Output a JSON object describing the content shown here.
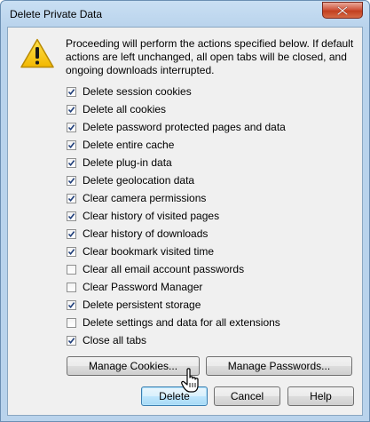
{
  "window": {
    "title": "Delete Private Data"
  },
  "icons": {
    "warning": "warning-icon",
    "close": "close-icon",
    "cursor": "hand-pointer-icon"
  },
  "message": "Proceeding will perform the actions specified below. If default actions are left unchanged, all open tabs will be closed, and ongoing downloads interrupted.",
  "options": [
    {
      "label": "Delete session cookies",
      "checked": true
    },
    {
      "label": "Delete all cookies",
      "checked": true
    },
    {
      "label": "Delete password protected pages and data",
      "checked": true
    },
    {
      "label": "Delete entire cache",
      "checked": true
    },
    {
      "label": "Delete plug-in data",
      "checked": true
    },
    {
      "label": "Delete geolocation data",
      "checked": true
    },
    {
      "label": "Clear camera permissions",
      "checked": true
    },
    {
      "label": "Clear history of visited pages",
      "checked": true
    },
    {
      "label": "Clear history of downloads",
      "checked": true
    },
    {
      "label": "Clear bookmark visited time",
      "checked": true
    },
    {
      "label": "Clear all email account passwords",
      "checked": false
    },
    {
      "label": "Clear Password Manager",
      "checked": false
    },
    {
      "label": "Delete persistent storage",
      "checked": true
    },
    {
      "label": "Delete settings and data for all extensions",
      "checked": false
    },
    {
      "label": "Close all tabs",
      "checked": true
    }
  ],
  "buttons": {
    "manage_cookies": "Manage Cookies...",
    "manage_passwords": "Manage Passwords...",
    "delete": "Delete",
    "cancel": "Cancel",
    "help": "Help"
  },
  "colors": {
    "title_bar": "#b9d3ec",
    "client_bg": "#f0f0f0",
    "close_red": "#c2401f",
    "warning_yellow": "#f2c300"
  }
}
